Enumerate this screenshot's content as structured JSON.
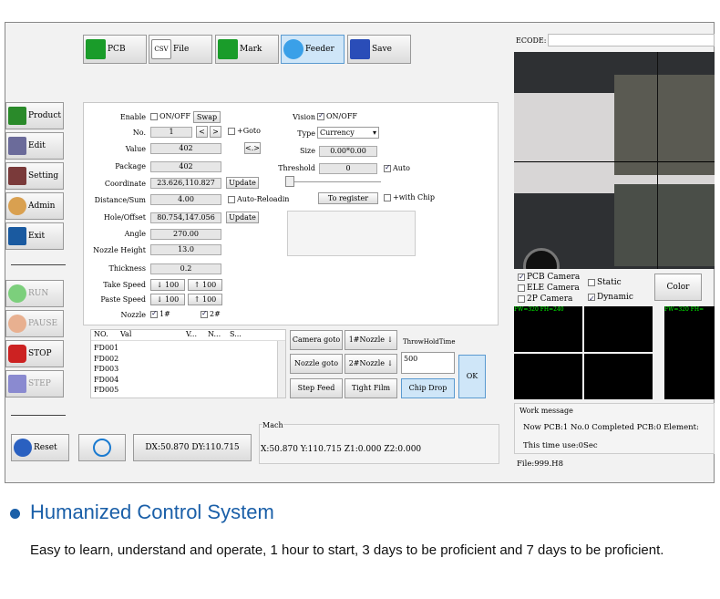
{
  "toolbar": [
    {
      "label": "PCB",
      "color": "#1a9c2a"
    },
    {
      "label": "File",
      "color": "#ffffff"
    },
    {
      "label": "Mark",
      "color": "#1a9c2a"
    },
    {
      "label": "Feeder",
      "color": "#3aa0e8"
    },
    {
      "label": "Save",
      "color": "#2a4db8"
    }
  ],
  "ecode": {
    "label": "ECODE:",
    "value": ""
  },
  "sidebar": [
    {
      "label": "Product",
      "color": "#2a8a2a"
    },
    {
      "label": "Edit",
      "color": "#6b6b9a"
    },
    {
      "label": "Setting",
      "color": "#7a3a3a"
    },
    {
      "label": "Admin",
      "color": "#d9a050"
    },
    {
      "label": "Exit",
      "color": "#1a5aa0"
    }
  ],
  "controls": [
    {
      "label": "RUN",
      "color": "#7ccf7c"
    },
    {
      "label": "PAUSE",
      "color": "#e8b090"
    },
    {
      "label": "STOP",
      "color": "#cc2222"
    },
    {
      "label": "STEP",
      "color": "#8a8ad0"
    }
  ],
  "form": {
    "enable_label": "Enable",
    "enable_opt": "ON/OFF",
    "swap": "Swap",
    "no_label": "No.",
    "no_value": "1",
    "prev": "<",
    "next": ">",
    "goto": "+Goto",
    "value_label": "Value",
    "value": "402",
    "swap_icon": "<.>",
    "package_label": "Package",
    "package": "402",
    "coord_label": "Coordinate",
    "coord": "23.626,110.827",
    "update": "Update",
    "dist_label": "Distance/Sum",
    "dist": "4.00",
    "auto_reload": "Auto-Reloadin",
    "hole_label": "Hole/Offset",
    "hole": "80.754,147.056",
    "update2": "Update",
    "angle_label": "Angle",
    "angle": "270.00",
    "nheight_label": "Nozzle Height",
    "nheight": "13.0",
    "thick_label": "Thickness",
    "thick": "0.2",
    "take_label": "Take Speed",
    "take_dn": "↓ 100",
    "take_up": "↑ 100",
    "paste_label": "Paste Speed",
    "paste_dn": "↓ 100",
    "paste_up": "↑ 100",
    "nozzle_label": "Nozzle",
    "n1": "1#",
    "n2": "2#",
    "vision_label": "Vision",
    "vision_opt": "ON/OFF",
    "type_label": "Type",
    "type_value": "Currency",
    "size_label": "Size",
    "size": "0.00*0.00",
    "thresh_label": "Threshold",
    "thresh": "0",
    "auto": "Auto",
    "register": "To register",
    "with_chip": "+with Chip"
  },
  "table": {
    "headers": [
      "NO.",
      "Val",
      "V...",
      "N...",
      "S..."
    ],
    "rows": [
      "FD001",
      "FD002",
      "FD003",
      "FD004",
      "FD005"
    ]
  },
  "actions": {
    "camera_goto": "Camera goto",
    "nozzle1": "1#Nozzle ↓",
    "throw": "ThrowHoldTime",
    "nozzle_goto": "Nozzle goto",
    "nozzle2": "2#Nozzle ↓",
    "throw_value": "500",
    "step_feed": "Step Feed",
    "tight_film": "Tight Film",
    "chip_drop": "Chip Drop",
    "ok": "OK"
  },
  "bottom": {
    "reset": "Reset",
    "dxdy": "DX:50.870 DY:110.715",
    "mach": "Mach",
    "mach_value": "X:50.870 Y:110.715 Z1:0.000 Z2:0.000"
  },
  "camera": {
    "pcb": "PCB Camera",
    "ele": "ELE Camera",
    "p2": "2P Camera",
    "static": "Static",
    "dynamic": "Dynamic",
    "color": "Color",
    "fw1": "FW=320 FH=240",
    "fw2": "FW=320 FH="
  },
  "work": {
    "title": "Work message",
    "line1": "Now PCB:1 No.0 Completed PCB:0 Element:",
    "line2": "This time use:0Sec",
    "file": "File:999.H8"
  },
  "caption": {
    "title": "Humanized Control System",
    "body": "Easy to learn, understand and operate, 1 hour to start, 3 days to be proficient and 7 days to be proficient."
  }
}
